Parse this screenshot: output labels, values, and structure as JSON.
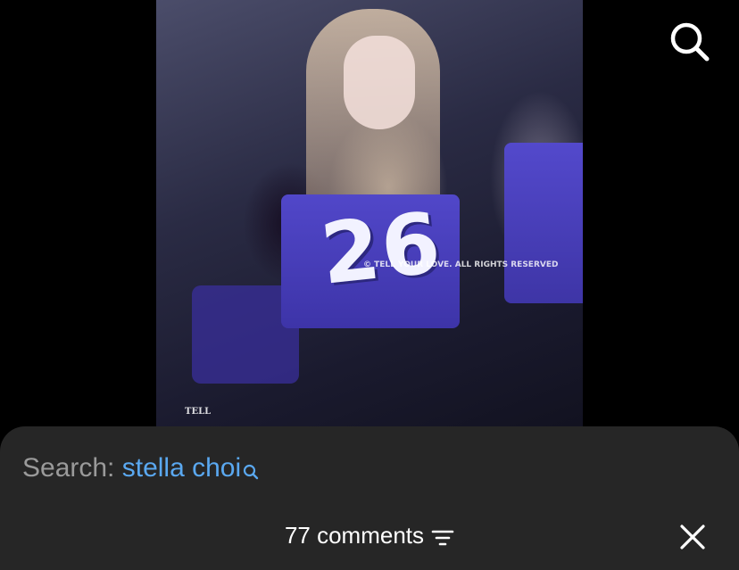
{
  "photo": {
    "jersey_number": "26",
    "watermark_text": "© TELL YOUR LOVE. ALL RIGHTS RESERVED",
    "tag_text": "TELL"
  },
  "header": {
    "search_icon": "search-icon"
  },
  "sheet": {
    "search_label": "Search:",
    "search_term": "stella choi",
    "search_term_icon": "search-icon",
    "comments_count_text": "77 comments",
    "sort_icon": "sort-icon",
    "close_icon": "close-icon"
  },
  "colors": {
    "background": "#000000",
    "sheet": "#262626",
    "accent": "#5aa8f0",
    "muted": "#9a9a9a",
    "text": "#ffffff"
  }
}
